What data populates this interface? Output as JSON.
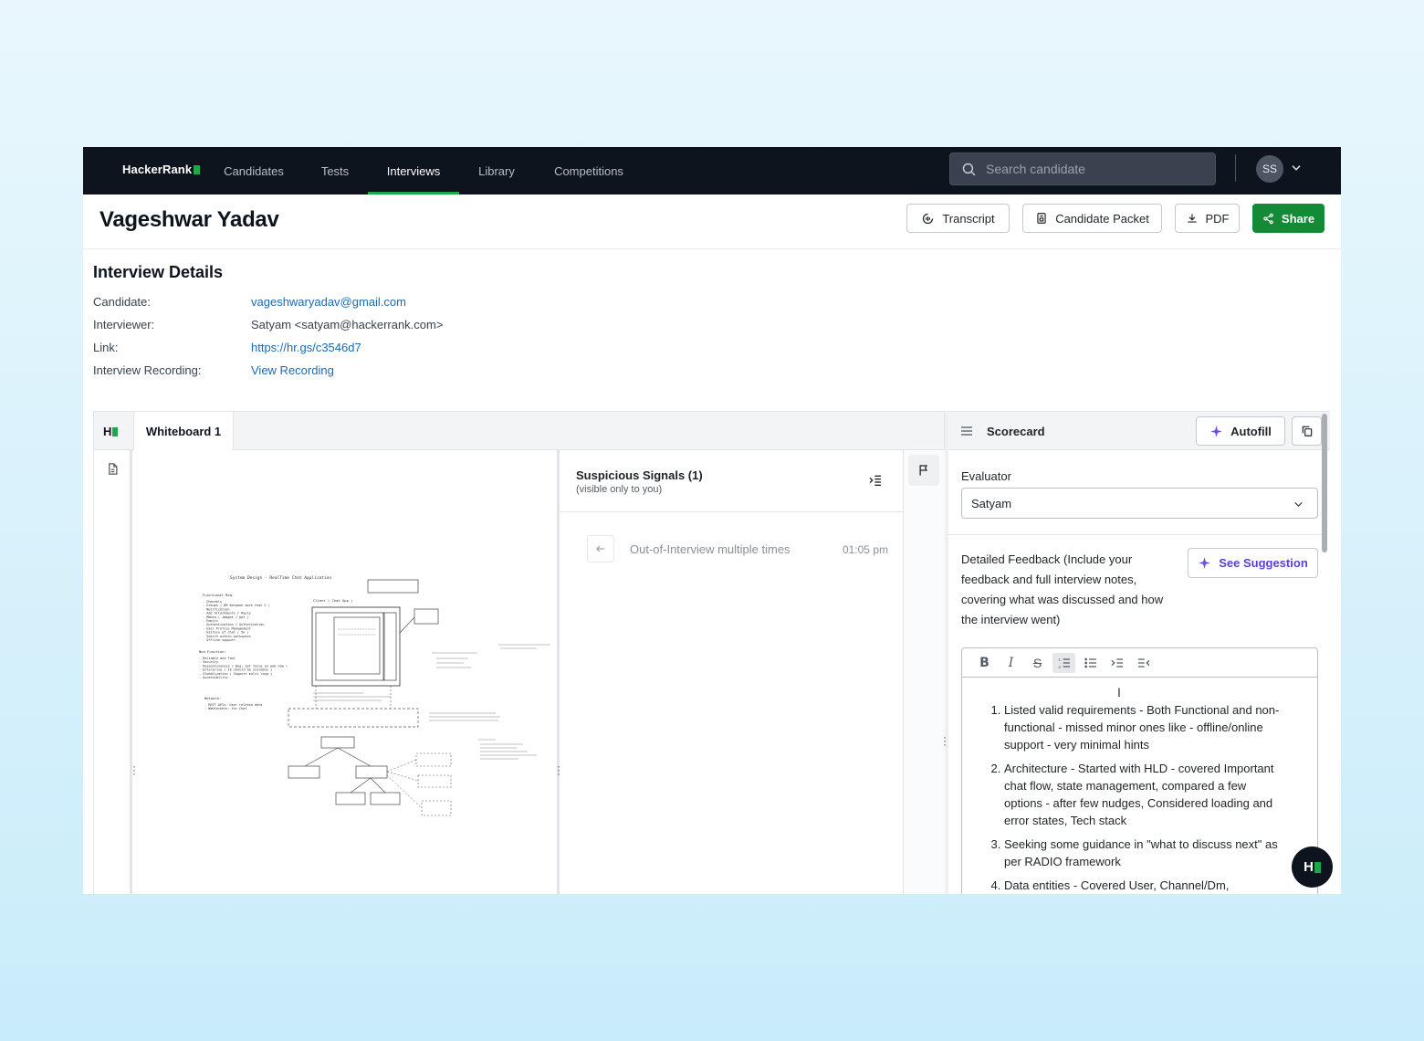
{
  "nav": {
    "logo": "HackerRank",
    "links": [
      "Candidates",
      "Tests",
      "Interviews",
      "Library",
      "Competitions"
    ],
    "active": "Interviews",
    "search_placeholder": "Search candidate",
    "avatar_initials": "SS"
  },
  "header": {
    "candidate_name": "Vageshwar Yadav",
    "buttons": {
      "transcript": "Transcript",
      "candidate_packet": "Candidate Packet",
      "pdf": "PDF",
      "share": "Share"
    }
  },
  "details": {
    "title": "Interview Details",
    "rows": [
      {
        "label": "Candidate:",
        "value": "vageshwaryadav@gmail.com"
      },
      {
        "label": "Interviewer:",
        "value": "Satyam <satyam@hackerrank.com>"
      },
      {
        "label": "Link:",
        "value": "https://hr.gs/c3546d7"
      },
      {
        "label": "Interview Recording:",
        "value": "View Recording"
      }
    ]
  },
  "workspace": {
    "logo": "H",
    "tab": "Whiteboard 1",
    "whiteboard": {
      "title": "System Design - RealTime Chat Application",
      "functional_heading": "Functional Req.",
      "functional": [
        "Channels",
        "Groups ( DM between more than 2 )",
        "Notification",
        "Add Attachments / Reply",
        "Media ( images / ppt )",
        "Emojis",
        "Authentication / Authorization",
        "User Profile Management",
        "History of chat ( 5k )",
        "Search within workspace",
        "Offline support"
      ],
      "nonfunctional_heading": "Non Function:",
      "nonfunctional": [
        "Reliable and Fast",
        "Security",
        "Responsiveness ( Bug, but focus on web now )",
        "Enterprise ( 1k should be scalable )",
        "Globalization ( Support multi lang )",
        "Accessibility"
      ],
      "network_heading": "Network:",
      "network": [
        "REST APIs: User related data",
        "WebSockets: for Chat"
      ],
      "client_label": "Client ( Chat App )"
    },
    "signals": {
      "title": "Suspicious Signals (1)",
      "subtitle": "(visible only to you)",
      "items": [
        {
          "text": "Out-of-Interview multiple times",
          "time": "01:05 pm"
        }
      ]
    }
  },
  "scorecard": {
    "title": "Scorecard",
    "autofill": "Autofill",
    "evaluator_label": "Evaluator",
    "evaluator_value": "Satyam",
    "feedback_label": "Detailed Feedback (Include your feedback and full interview notes, covering what was discussed and how the interview went)",
    "suggestion": "See Suggestion",
    "notes": [
      "Listed valid requirements - Both Functional and non-functional - missed minor ones like - offline/online support - very minimal hints",
      "Architecture - Started with HLD - covered Important chat flow, state management, compared a few options - after few nudges, Considered loading and error states, Tech stack",
      "Seeking some guidance in \"what to discuss next\" as per RADIO framework",
      "Data entities - Covered User, Channel/Dm,"
    ]
  },
  "fab": "H"
}
